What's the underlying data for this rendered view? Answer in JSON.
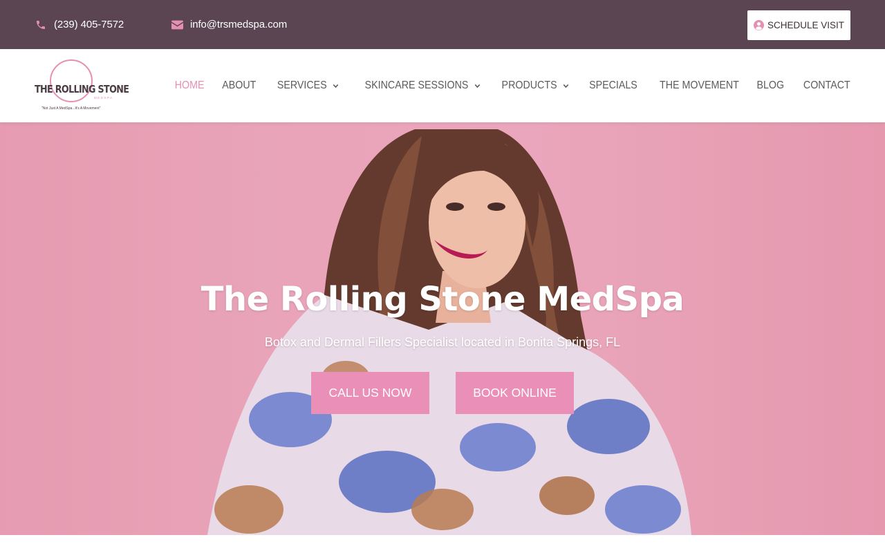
{
  "topbar": {
    "phone": "(239) 405-7572",
    "email": "info@trsmedspa.com",
    "schedule_label": "SCHEDULE VISIT",
    "icons": {
      "phone": "phone-icon",
      "email": "envelope-icon",
      "schedule": "user-circle-icon"
    },
    "background": "#5b4553",
    "icon_color": "#e58fb3"
  },
  "logo": {
    "text": "THE ROLLING STONE",
    "sub": "MEDSPA",
    "tagline": "\"Not Just A MedSpa...It's A Movement\""
  },
  "nav": {
    "items": [
      {
        "label": "HOME",
        "active": true
      },
      {
        "label": "ABOUT"
      },
      {
        "label": "SERVICES",
        "dropdown": true
      },
      {
        "label": "SKINCARE SESSIONS",
        "dropdown": true
      },
      {
        "label": "PRODUCTS",
        "dropdown": true
      },
      {
        "label": "SPECIALS"
      },
      {
        "label": "THE MOVEMENT"
      },
      {
        "label": "BLOG"
      },
      {
        "label": "CONTACT"
      }
    ],
    "active_color": "#e58fb3"
  },
  "hero": {
    "title": "The Rolling Stone MedSpa",
    "subtitle": "Botox and Dermal Fillers Specialist located in Bonita Springs, FL",
    "call_label": "CALL US NOW",
    "book_label": "BOOK ONLINE",
    "button_color": "#ea8fb7",
    "background": "#eaa7bc"
  }
}
